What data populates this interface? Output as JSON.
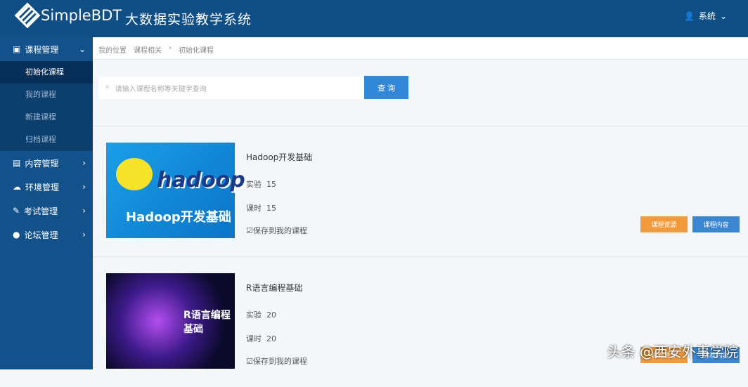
{
  "header": {
    "logo": "SimpleBDT",
    "system_title": "大数据实验教学系统",
    "user": "系统"
  },
  "sidebar": {
    "groups": [
      {
        "label": "课程管理",
        "icon": "bag-icon",
        "expanded": true,
        "items": [
          "初始化课程",
          "我的课程",
          "新建课程",
          "归档课程"
        ]
      },
      {
        "label": "内容管理",
        "icon": "file-icon"
      },
      {
        "label": "环境管理",
        "icon": "cloud-icon"
      },
      {
        "label": "考试管理",
        "icon": "exam-icon"
      },
      {
        "label": "论坛管理",
        "icon": "chat-icon"
      }
    ]
  },
  "breadcrumb": [
    "我的位置",
    "课程相关",
    "初始化课程"
  ],
  "search": {
    "placeholder": "请输入课程名称等关键字查询",
    "button": "查 询"
  },
  "courses": [
    {
      "title": "Hadoop开发基础",
      "image_text": "Hadoop开发基础",
      "image_logo": "hadoop",
      "exp_label": "实验",
      "exp": "15",
      "hours_label": "课时",
      "hours": "15",
      "save": "保存到我的课程",
      "btn_res": "课程资源",
      "btn_content": "课程内容"
    },
    {
      "title": "R语言编程基础",
      "image_text": "R语言编程基础",
      "exp_label": "实验",
      "exp": "20",
      "hours_label": "课时",
      "hours": "20",
      "save": "保存到我的课程",
      "btn_res": "课程资源",
      "btn_content": "课程内容"
    }
  ],
  "watermark": "头条 @西安外事学院",
  "colors": {
    "header": "#0f4f86",
    "primary": "#3188d8",
    "orange": "#f39a3c"
  }
}
